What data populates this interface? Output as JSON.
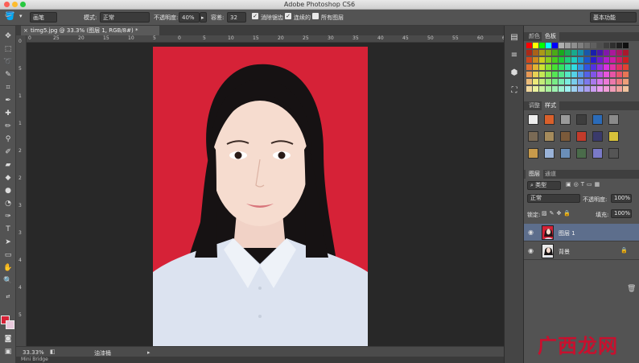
{
  "app": {
    "title": "Adobe Photoshop CS6"
  },
  "options_bar": {
    "brush_preset": "画笔",
    "mode_label": "模式:",
    "mode_value": "正常",
    "opacity_label": "不透明度:",
    "opacity_value": "40%",
    "flow_label": "容差:",
    "flow_value": "32",
    "antialias_label": "消除锯齿",
    "contiguous_label": "连续的",
    "all_layers_label": "所有图层",
    "workspace": "基本功能"
  },
  "document": {
    "tab_title": "timg5.jpg @ 33.3% (图层 1, RGB/8#) *",
    "zoom": "33.33%",
    "status_text": "油漆桶",
    "bridge_label": "Mini Bridge"
  },
  "ruler": {
    "top_ticks": [
      "0",
      "25",
      "20",
      "15",
      "10",
      "5",
      "0",
      "5",
      "10",
      "15",
      "20",
      "25",
      "30",
      "35",
      "40",
      "45",
      "50",
      "55",
      "60",
      "65"
    ],
    "left_ticks": [
      "0",
      "5",
      "1",
      "1",
      "2",
      "2",
      "3",
      "3",
      "4",
      "4",
      "5"
    ]
  },
  "panels": {
    "color_tabs": [
      "颜色",
      "色板"
    ],
    "style_tabs": [
      "调整",
      "样式"
    ],
    "layers_tabs": [
      "图层",
      "通道"
    ],
    "filter_label": "类型",
    "blend_mode": "正常",
    "opacity_label": "不透明度:",
    "opacity_value": "100%",
    "lock_label": "锁定:",
    "fill_label": "填充:",
    "fill_value": "100%",
    "layers": [
      {
        "name": "图层 1",
        "selected": true
      },
      {
        "name": "背景",
        "selected": false
      }
    ]
  },
  "watermark": {
    "text": "广西龙网"
  },
  "colors": {
    "background_red": "#d62237",
    "ui_dark": "#535353",
    "canvas_bg": "#282828"
  }
}
